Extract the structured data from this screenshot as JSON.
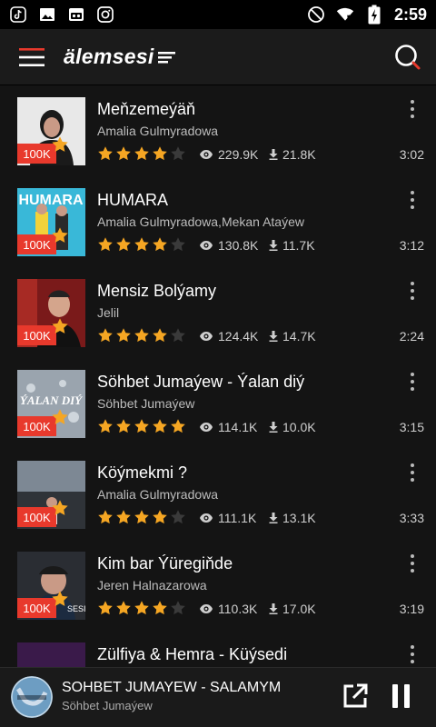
{
  "status_bar": {
    "time": "2:59",
    "left_icons": [
      "tiktok-icon",
      "image-icon",
      "media-icon",
      "instagram-icon"
    ],
    "right_icons": [
      "do-not-disturb-icon",
      "wifi-icon",
      "battery-charging-icon"
    ]
  },
  "app_bar": {
    "logo_text": "älemsesi",
    "menu_icon": "menu-icon",
    "search_icon": "search-icon"
  },
  "colors": {
    "accent": "#e8392c",
    "star": "#f5a623",
    "star_empty": "#3a3a3a"
  },
  "songs": [
    {
      "title": "Meňzemeýäň",
      "artist": "Amalia Gulmyradowa",
      "badge": "100K",
      "rating": 4,
      "views": "229.9K",
      "downloads": "21.8K",
      "duration": "3:02"
    },
    {
      "title": "HUMARA",
      "artist": "Amalia Gulmyradowa,Mekan Ataýew",
      "badge": "100K",
      "rating": 4,
      "views": "130.8K",
      "downloads": "11.7K",
      "duration": "3:12"
    },
    {
      "title": "Mensiz Bolýamy",
      "artist": "Jelil",
      "badge": "100K",
      "rating": 4,
      "views": "124.4K",
      "downloads": "14.7K",
      "duration": "2:24"
    },
    {
      "title": "Söhbet Jumaýew - Ýalan diý",
      "artist": "Söhbet Jumaýew",
      "badge": "100K",
      "rating": 5,
      "views": "114.1K",
      "downloads": "10.0K",
      "duration": "3:15"
    },
    {
      "title": "Köýmekmi ?",
      "artist": "Amalia Gulmyradowa",
      "badge": "100K",
      "rating": 4,
      "views": "111.1K",
      "downloads": "13.1K",
      "duration": "3:33"
    },
    {
      "title": "Kim bar Ýüregiňde",
      "artist": "Jeren Halnazarowa",
      "badge": "100K",
      "rating": 4,
      "views": "110.3K",
      "downloads": "17.0K",
      "duration": "3:19"
    },
    {
      "title": "Zülfiya & Hemra - Küýsedi",
      "artist": "",
      "badge": "",
      "rating": 0,
      "views": "",
      "downloads": "",
      "duration": ""
    }
  ],
  "now_playing": {
    "title": "SOHBET JUMAYEW - SALAMYM",
    "artist": "Söhbet Jumaýew",
    "open_icon": "open-external-icon",
    "pause_icon": "pause-icon"
  }
}
